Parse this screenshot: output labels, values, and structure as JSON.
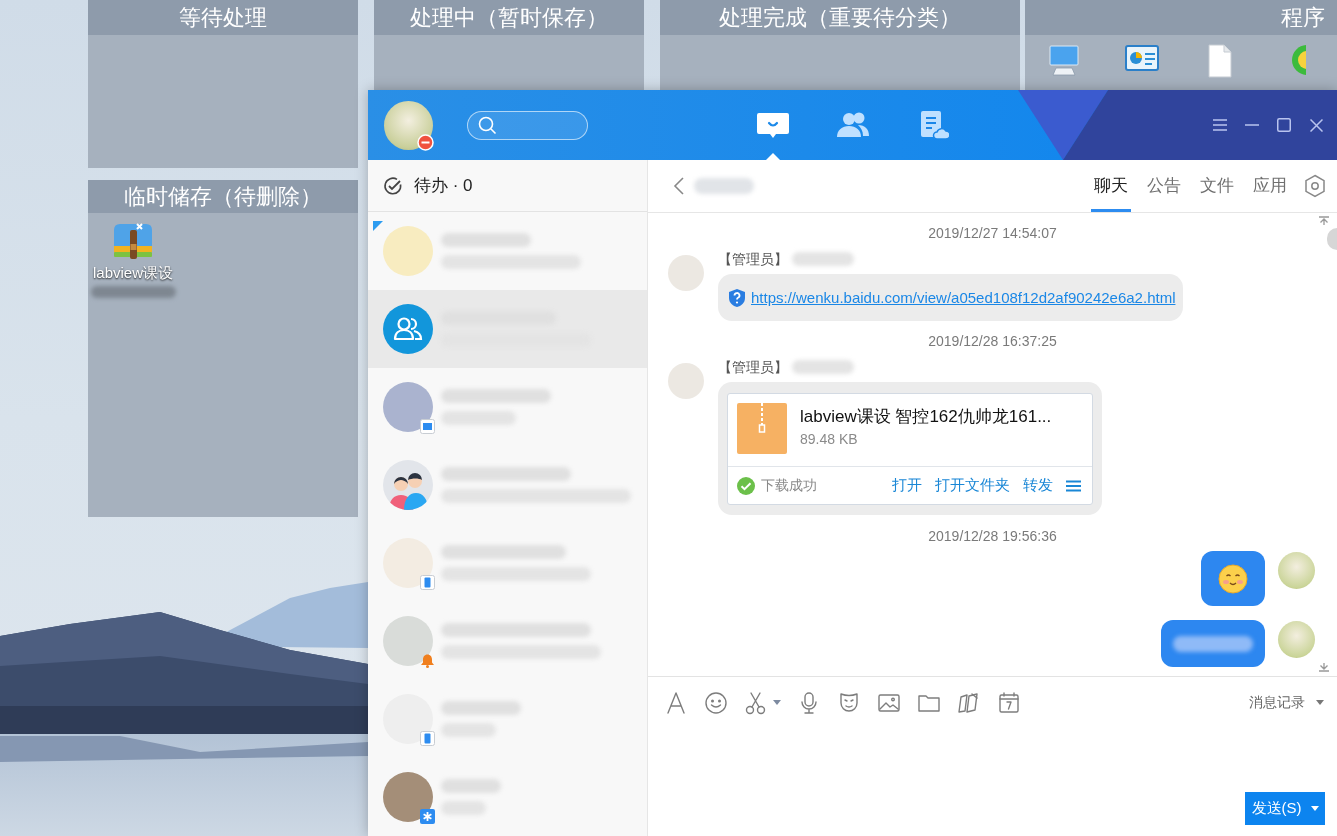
{
  "desktop": {
    "fences": [
      {
        "title": "等待处理"
      },
      {
        "title": "处理中（暂时保存）"
      },
      {
        "title": "处理完成（重要待分类）"
      },
      {
        "title": "程序",
        "items": [
          {
            "kind": "computer"
          },
          {
            "kind": "control_panel"
          },
          {
            "kind": "file"
          },
          {
            "kind": "app"
          }
        ]
      },
      {
        "title": "临时储存（待删除）",
        "items": [
          {
            "kind": "archive",
            "label": "labview课设"
          }
        ]
      }
    ]
  },
  "chat_window": {
    "user": {
      "badge": {
        "kind": "busy"
      }
    },
    "nav_tabs": [
      {
        "kind": "messages",
        "selected": true
      },
      {
        "kind": "contacts",
        "selected": false
      },
      {
        "kind": "documents",
        "selected": false
      }
    ],
    "todo": {
      "label": "待办 · 0"
    },
    "conversations": [
      {
        "kind": "picture",
        "pinned": true,
        "selected": false
      },
      {
        "kind": "group",
        "pinned": false,
        "selected": true
      },
      {
        "kind": "picture",
        "badge": {
          "kind": "desktop"
        },
        "pinned": false,
        "selected": false
      },
      {
        "kind": "couple",
        "pinned": false,
        "selected": false
      },
      {
        "kind": "picture",
        "badge": {
          "kind": "mobile"
        },
        "pinned": false,
        "selected": false
      },
      {
        "kind": "picture",
        "badge": {
          "kind": "bell"
        },
        "pinned": false,
        "selected": false
      },
      {
        "kind": "picture",
        "badge": {
          "kind": "mobile"
        },
        "pinned": false,
        "selected": false
      },
      {
        "kind": "picture",
        "badge": {
          "kind": "star"
        },
        "pinned": false,
        "selected": false
      }
    ],
    "chat": {
      "tabs": [
        {
          "label": "聊天",
          "selected": true
        },
        {
          "label": "公告",
          "selected": false
        },
        {
          "label": "文件",
          "selected": false
        },
        {
          "label": "应用",
          "selected": false
        }
      ],
      "messages": [
        {
          "kind": "timestamp",
          "text": "2019/12/27 14:54:07"
        },
        {
          "kind": "link",
          "outgoing": false,
          "sender_role": "【管理员】",
          "url": "https://wenku.baidu.com/view/a05ed108f12d2af90242e6a2.html"
        },
        {
          "kind": "timestamp",
          "text": "2019/12/28 16:37:25"
        },
        {
          "kind": "file",
          "outgoing": false,
          "sender_role": "【管理员】",
          "file_name": "labview课设 智控162仇帅龙161...",
          "size": "89.48 KB",
          "status": "下载成功",
          "actions": [
            "打开",
            "打开文件夹",
            "转发"
          ]
        },
        {
          "kind": "timestamp",
          "text": "2019/12/28 19:56:36"
        },
        {
          "kind": "emoji",
          "outgoing": true
        },
        {
          "kind": "redacted",
          "outgoing": true
        }
      ],
      "toolbar": {
        "tools": [
          {
            "kind": "font"
          },
          {
            "kind": "emoji"
          },
          {
            "kind": "screenshot"
          },
          {
            "kind": "voice"
          },
          {
            "kind": "sticker"
          },
          {
            "kind": "image"
          },
          {
            "kind": "folder"
          },
          {
            "kind": "remote"
          },
          {
            "kind": "calendar"
          }
        ],
        "history_label": "消息记录"
      },
      "send_label": "发送(S)"
    }
  }
}
